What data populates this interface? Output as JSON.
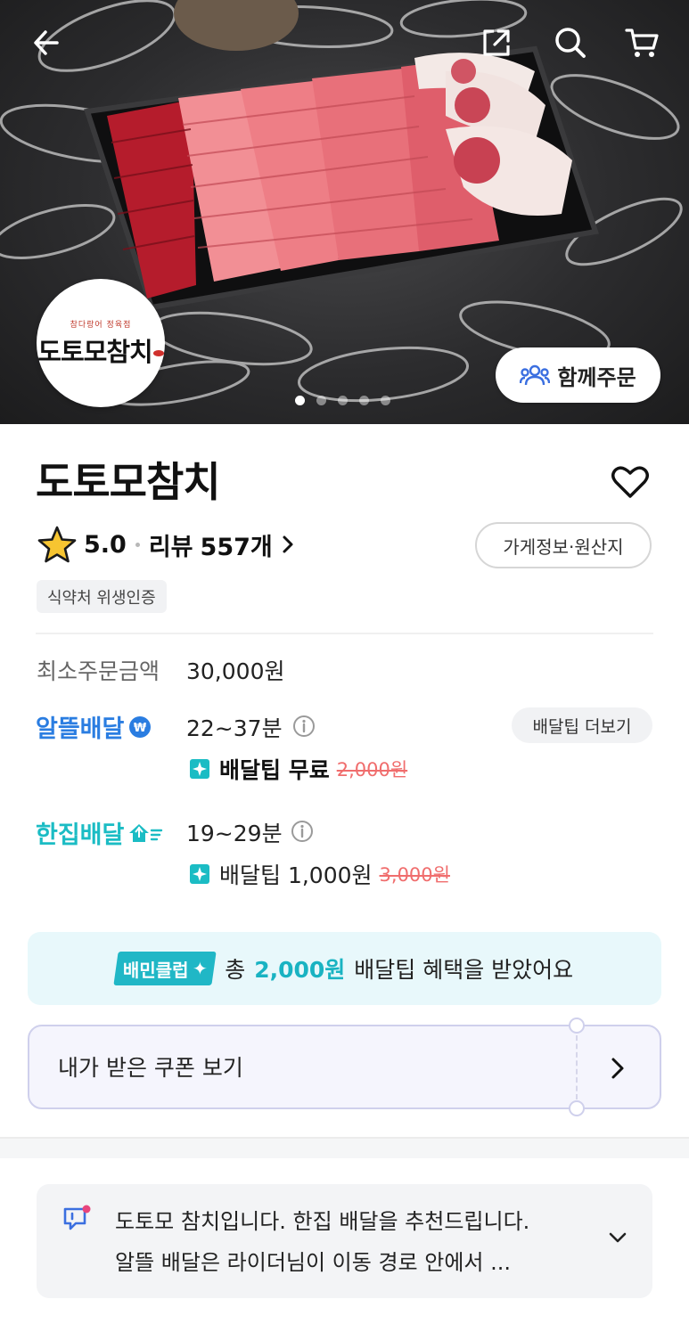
{
  "store": {
    "name": "도토모참치",
    "logo_text": "도토모참치",
    "logo_subtext": "참다랑어 정육점",
    "rating": "5.0",
    "review_label": "리뷰",
    "review_count": "557개",
    "info_button": "가게정보·원산지",
    "cert_badge": "식약처 위생인증"
  },
  "hero": {
    "group_order_label": "함께주문",
    "carousel_count": 5,
    "carousel_active": 1
  },
  "min_order": {
    "label": "최소주문금액",
    "value": "30,000원"
  },
  "delivery": {
    "tip_more_label": "배달팁 더보기",
    "options": [
      {
        "brand": "알뜰배달",
        "brand_color": "#2a7de1",
        "time": "22~37분",
        "tip_text": "배달팁 무료",
        "tip_original": "2,000원"
      },
      {
        "brand": "한집배달",
        "brand_color": "#1bbcc4",
        "time": "19~29분",
        "tip_text": "배달팁 1,000원",
        "tip_original": "3,000원"
      }
    ]
  },
  "club_banner": {
    "badge": "배민클럽",
    "prefix": "총",
    "amount": "2,000원",
    "suffix": "배달팁 혜택을 받았어요"
  },
  "coupon": {
    "label": "내가 받은 쿠폰 보기"
  },
  "notice": {
    "line1": "도토모 참치입니다. 한집 배달을 추천드립니다.",
    "line2": "알뜰 배달은 라이더님이 이동 경로 안에서 ..."
  },
  "icons": {
    "back": "back-arrow-icon",
    "share": "share-icon",
    "search": "search-icon",
    "cart": "cart-icon",
    "heart": "heart-icon",
    "star": "star-icon",
    "info": "info-icon",
    "group": "group-icon",
    "notice": "notice-icon"
  },
  "colors": {
    "alddeul_blue": "#2a7de1",
    "hanjip_teal": "#1bbcc4",
    "club_teal": "#20b7c6",
    "strike_red": "#f06d6d",
    "star_yellow": "#f7c531"
  }
}
